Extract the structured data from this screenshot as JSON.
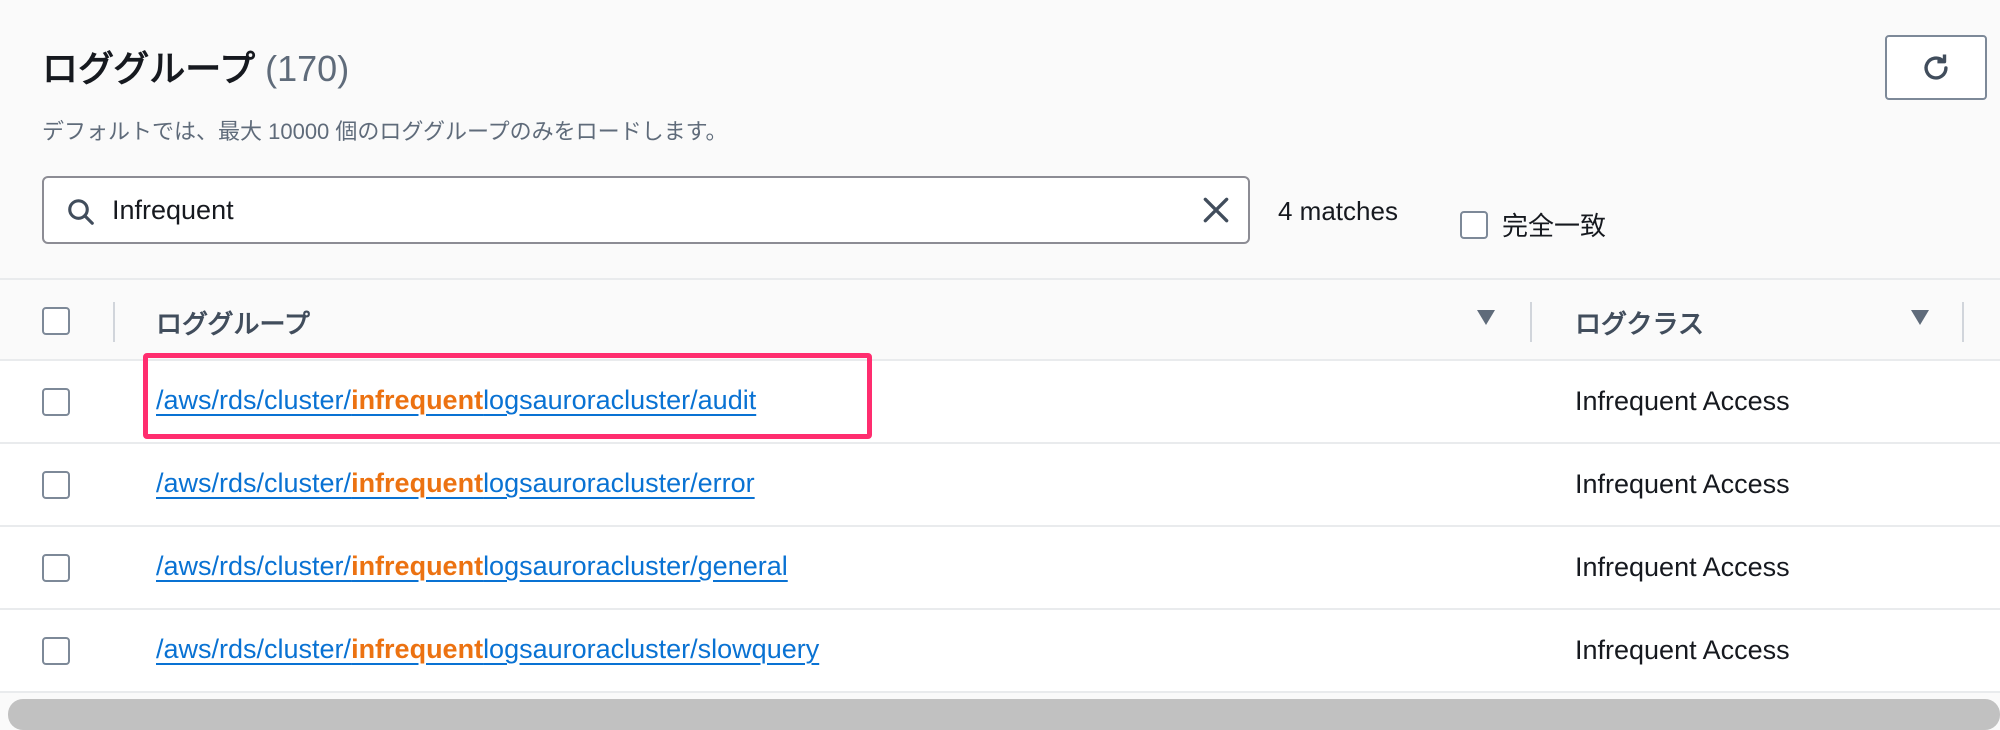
{
  "header": {
    "title": "ロググループ",
    "count": "(170)",
    "subtitle": "デフォルトでは、最大 10000 個のロググループのみをロードします。",
    "refresh_icon": "refresh-icon"
  },
  "search": {
    "value": "Infrequent",
    "matches": "4 matches",
    "exact_match_label": "完全一致",
    "exact_match_checked": false
  },
  "table": {
    "columns": [
      "ロググループ",
      "ログクラス"
    ],
    "rows": [
      {
        "prefix": "/aws/rds/cluster/",
        "highlight": "infrequent",
        "suffix": "logsauroracluster/audit",
        "log_class": "Infrequent Access",
        "highlighted_box": true
      },
      {
        "prefix": "/aws/rds/cluster/",
        "highlight": "infrequent",
        "suffix": "logsauroracluster/error",
        "log_class": "Infrequent Access"
      },
      {
        "prefix": "/aws/rds/cluster/",
        "highlight": "infrequent",
        "suffix": "logsauroracluster/general",
        "log_class": "Infrequent Access"
      },
      {
        "prefix": "/aws/rds/cluster/",
        "highlight": "infrequent",
        "suffix": "logsauroracluster/slowquery",
        "log_class": "Infrequent Access"
      }
    ]
  },
  "colors": {
    "link": "#0972d3",
    "highlight": "#ec7211",
    "annotation_box": "#ff2d6f"
  }
}
